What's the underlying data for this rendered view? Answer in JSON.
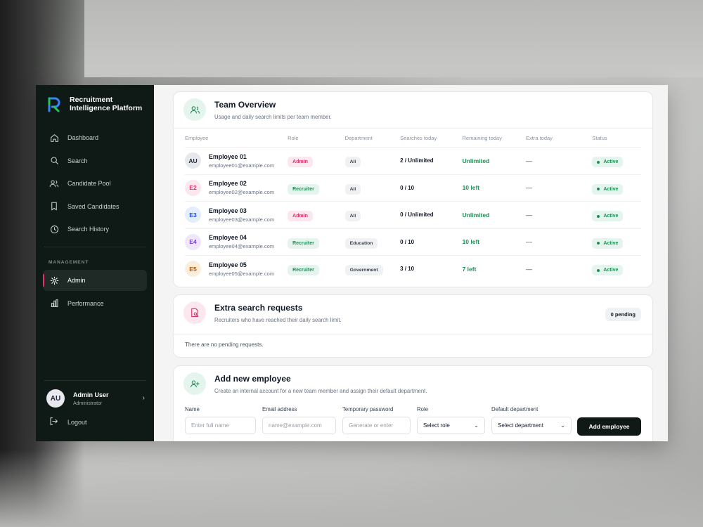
{
  "brand": {
    "name_line1": "Recruitment",
    "name_line2": "Intelligence Platform"
  },
  "nav": {
    "items": [
      {
        "label": "Dashboard",
        "icon": "home-icon"
      },
      {
        "label": "Search",
        "icon": "search-icon"
      },
      {
        "label": "Candidate Pool",
        "icon": "users-icon"
      },
      {
        "label": "Saved Candidates",
        "icon": "bookmark-icon"
      },
      {
        "label": "Search History",
        "icon": "clock-icon"
      }
    ],
    "section_label": "MANAGEMENT",
    "management": [
      {
        "label": "Admin",
        "icon": "gear-icon",
        "active": true
      },
      {
        "label": "Performance",
        "icon": "bar-chart-icon"
      }
    ]
  },
  "user": {
    "initials": "AU",
    "name": "Admin User",
    "role": "Administrator"
  },
  "logout": {
    "label": "Logout"
  },
  "team": {
    "title": "Team Overview",
    "subtitle": "Usage and daily search limits per team member.",
    "columns": [
      "Employee",
      "Role",
      "Department",
      "Searches today",
      "Remaining today",
      "Extra today",
      "Status"
    ],
    "rows": [
      {
        "initials": "AU",
        "name": "Employee 01",
        "email": "employee01@example.com",
        "role": "Admin",
        "department": "All",
        "searches": "2 / Unlimited",
        "remaining": "Unlimited",
        "extra": "—",
        "status": "Active"
      },
      {
        "initials": "E2",
        "name": "Employee 02",
        "email": "employee02@example.com",
        "role": "Recruiter",
        "department": "All",
        "searches": "0 / 10",
        "remaining": "10 left",
        "extra": "—",
        "status": "Active"
      },
      {
        "initials": "E3",
        "name": "Employee 03",
        "email": "employee03@example.com",
        "role": "Admin",
        "department": "All",
        "searches": "0 / Unlimited",
        "remaining": "Unlimited",
        "extra": "—",
        "status": "Active"
      },
      {
        "initials": "E4",
        "name": "Employee 04",
        "email": "employee04@example.com",
        "role": "Recruiter",
        "department": "Education",
        "searches": "0 / 10",
        "remaining": "10 left",
        "extra": "—",
        "status": "Active"
      },
      {
        "initials": "E5",
        "name": "Employee 05",
        "email": "employee05@example.com",
        "role": "Recruiter",
        "department": "Government",
        "searches": "3 / 10",
        "remaining": "7 left",
        "extra": "—",
        "status": "Active"
      }
    ]
  },
  "requests": {
    "title": "Extra search requests",
    "subtitle": "Recruiters who have reached their daily search limit.",
    "badge": "0 pending",
    "empty": "There are no pending requests."
  },
  "add": {
    "title": "Add new employee",
    "subtitle": "Create an internal account for a new team member and assign their default department.",
    "name_label": "Name",
    "name_placeholder": "Enter full name",
    "email_label": "Email address",
    "email_placeholder": "name@example.com",
    "password_label": "Temporary password",
    "password_placeholder": "Generate or enter",
    "role_label": "Role",
    "role_value": "Select role",
    "dept_label": "Default department",
    "dept_value": "Select department",
    "button": "Add employee"
  },
  "colors": {
    "accent_green": "#1f8f56",
    "accent_pink": "#d6336c",
    "sidebar_bg": "#0f1a16"
  }
}
